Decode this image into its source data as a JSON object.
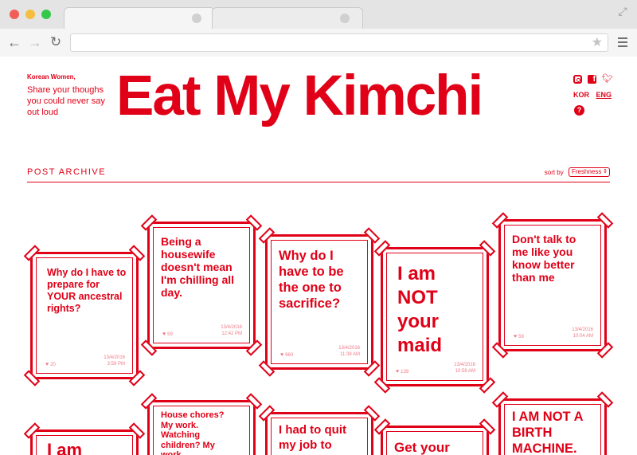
{
  "browser": {
    "active_tab_title": "",
    "url": ""
  },
  "header": {
    "tagline_head": "Korean Women,",
    "tagline_body": "Share your thoughs you could never say out loud",
    "brand": "Eat My Kimchi",
    "languages": [
      "KOR",
      "ENG"
    ],
    "help": "?",
    "social_icons": [
      "instagram-icon",
      "facebook-icon",
      "twitter-icon"
    ]
  },
  "archive": {
    "title": "POST ARCHIVE",
    "sort_label": "sort by",
    "sort_value": "Freshness"
  },
  "posts": [
    {
      "text": "Why do I have to prepare for YOUR ancestral rights?",
      "likes": "20",
      "date": "13/4/2016",
      "time": "3:59 PM"
    },
    {
      "text": "Being a housewife doesn't mean I'm chilling all day.",
      "likes": "59",
      "date": "13/4/2016",
      "time": "12:42 PM"
    },
    {
      "text": "Why do I have to be the one to sacrifice?",
      "likes": "960",
      "date": "13/4/2016",
      "time": "11:38 AM"
    },
    {
      "text": "I am NOT your maid",
      "likes": "139",
      "date": "13/4/2016",
      "time": "10:58 AM"
    },
    {
      "text": "Don't talk to me like you know better than me",
      "likes": "59",
      "date": "13/4/2016",
      "time": "10:04 AM"
    },
    {
      "text": "I am",
      "likes": "",
      "date": "",
      "time": ""
    },
    {
      "text": "House chores? My work. Watching children? My work.",
      "likes": "",
      "date": "",
      "time": ""
    },
    {
      "text": "I had to quit my job to",
      "likes": "",
      "date": "",
      "time": ""
    },
    {
      "text": "Get your",
      "likes": "",
      "date": "",
      "time": ""
    },
    {
      "text": "I AM NOT A BIRTH MACHINE.",
      "likes": "",
      "date": "",
      "time": ""
    }
  ],
  "colors": {
    "brand_red": "#e00017",
    "meta_pink": "#f07a86"
  }
}
